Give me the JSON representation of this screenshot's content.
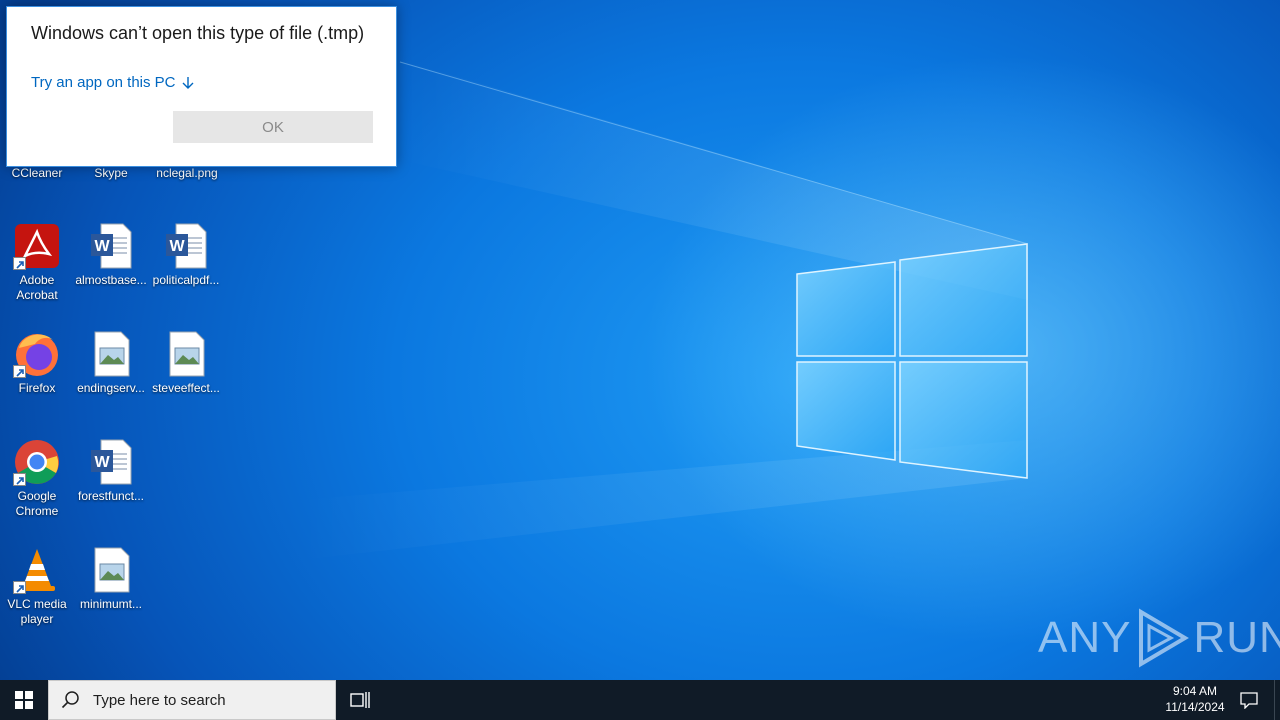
{
  "dialog": {
    "title": "Windows can’t open this type of file (.tmp)",
    "link_label": "Try an app on this PC",
    "link_icon": "arrow-down-icon",
    "ok_label": "OK"
  },
  "desktop": {
    "partial_labels": [
      "CCleaner",
      "Skype",
      "nclegal.png"
    ],
    "icons": [
      {
        "label": "Adobe Acrobat",
        "icon": "adobe-acrobat-icon"
      },
      {
        "label": "almostbase...",
        "icon": "word-document-icon"
      },
      {
        "label": "politicalpdf...",
        "icon": "word-document-icon"
      },
      {
        "label": "Firefox",
        "icon": "firefox-icon"
      },
      {
        "label": "endingserv...",
        "icon": "image-file-icon"
      },
      {
        "label": "steveeffect...",
        "icon": "image-file-icon"
      },
      {
        "label": "Google Chrome",
        "icon": "chrome-icon"
      },
      {
        "label": "forestfunct...",
        "icon": "word-document-icon"
      },
      {
        "label": "VLC media player",
        "icon": "vlc-icon"
      },
      {
        "label": "minimumt...",
        "icon": "image-file-icon"
      }
    ]
  },
  "watermark": {
    "text_left": "ANY",
    "text_right": "RUN"
  },
  "taskbar": {
    "search_placeholder": "Type here to search",
    "time": "9:04 AM",
    "date": "11/14/2024"
  },
  "colors": {
    "accent": "#0067c0",
    "taskbar": "#101b27",
    "wallpaper": "#0b78e0"
  }
}
